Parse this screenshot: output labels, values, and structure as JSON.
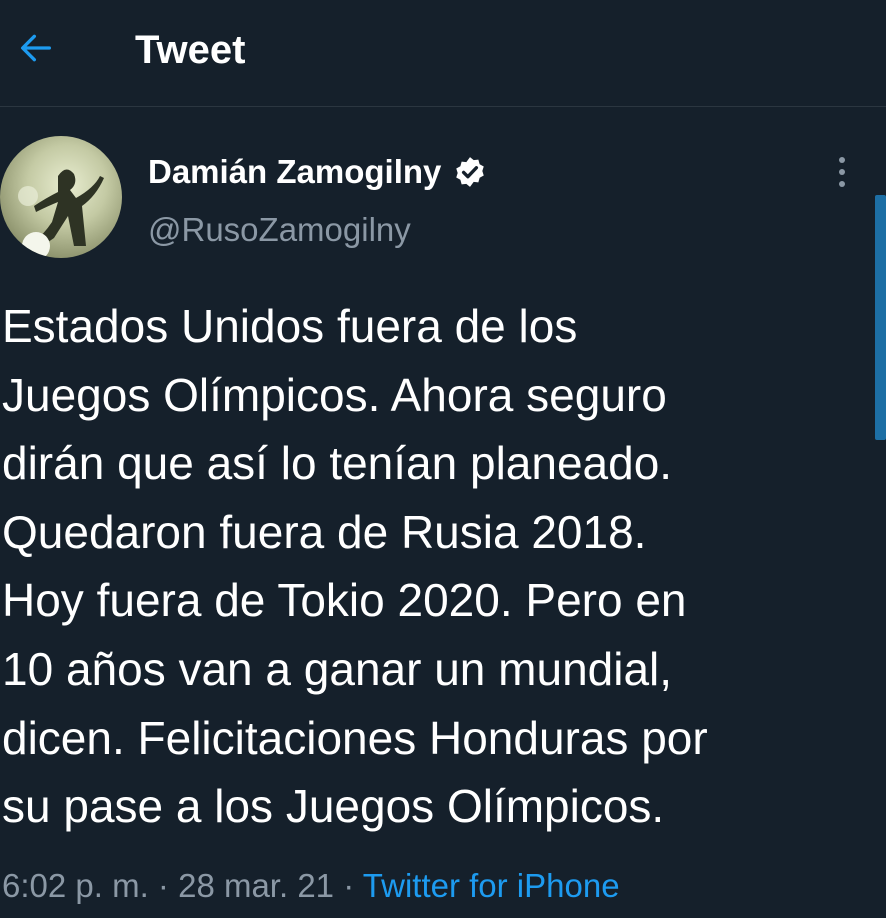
{
  "header": {
    "title": "Tweet",
    "back_icon": "arrow-left-icon",
    "accent_color": "#1d9bf0"
  },
  "tweet": {
    "author": {
      "name": "Damián Zamogilny",
      "handle": "@RusoZamogilny",
      "verified": true
    },
    "text": "Estados Unidos fuera de los\nJuegos Olímpicos. Ahora seguro\ndirán que así lo tenían planeado.\nQuedaron fuera de Rusia 2018.\nHoy fuera de Tokio 2020. Pero en\n10 años van a ganar un mundial,\ndicen. Felicitaciones Honduras por\nsu pase a los Juegos Olímpicos.",
    "time": "6:02 p. m.",
    "date": "28 mar. 21",
    "source": "Twitter for iPhone",
    "separator": "·"
  },
  "colors": {
    "background": "#15202b",
    "text_primary": "#ffffff",
    "text_secondary": "#8b98a5",
    "link": "#1d9bf0"
  }
}
